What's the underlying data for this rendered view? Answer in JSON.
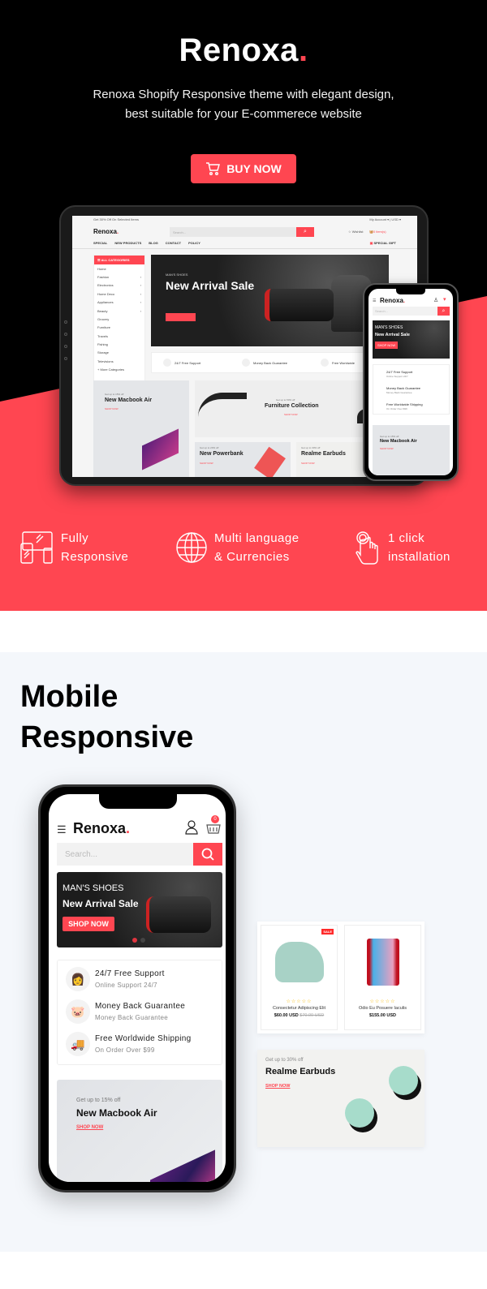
{
  "hero": {
    "brand": "Renoxa",
    "brand_dot": ".",
    "tagline_line1": "Renoxa Shopify Responsive theme with elegant design,",
    "tagline_line2": "best suitable for your E-commerece website",
    "buy_button": "BUY NOW",
    "colors": {
      "accent": "#ff4651",
      "dark": "#000000"
    }
  },
  "tablet": {
    "topbar_left": "Get 30% Off On Selected Items",
    "topbar_right": "My Account ▾  |  USD ▾",
    "logo": "Renoxa",
    "search_placeholder": "Search...",
    "wishlist": "Wishlist",
    "cart": "0 item(s)",
    "nav": [
      "SPECIAL",
      "NEW PRODUCTS",
      "BLOG",
      "CONTACT",
      "POLICY"
    ],
    "special_gift": "SPECIAL GIFT",
    "categories_header": "ALL CATEGORIES",
    "categories": [
      {
        "label": "Home",
        "arrow": ""
      },
      {
        "label": "Fashion",
        "arrow": "›"
      },
      {
        "label": "Electronics",
        "arrow": "›"
      },
      {
        "label": "Home Deco",
        "arrow": "›"
      },
      {
        "label": "Appliances",
        "arrow": "›"
      },
      {
        "label": "Beauty",
        "arrow": "›"
      },
      {
        "label": "Grocery",
        "arrow": ""
      },
      {
        "label": "Furniture",
        "arrow": ""
      },
      {
        "label": "Travels",
        "arrow": ""
      },
      {
        "label": "Fishing",
        "arrow": ""
      },
      {
        "label": "Storage",
        "arrow": ""
      },
      {
        "label": "Televisions",
        "arrow": ""
      },
      {
        "label": "+ More Categories",
        "arrow": ""
      }
    ],
    "banner_sub": "MAN'S SHOES",
    "banner_title": "New Arrival Sale",
    "features": [
      "24/7 Free Support",
      "Money Back Guarantee",
      "Free Worldwide"
    ],
    "promos": [
      {
        "sub": "Get up to 15% off",
        "title": "New Macbook Air",
        "link": "SHOP NOW"
      },
      {
        "sub": "Get up to 50% off",
        "title": "Furniture Collection",
        "link": "SHOP NOW"
      },
      {
        "sub": "Get up to 20% off",
        "title": "New Powerbank",
        "link": "SHOP NOW"
      },
      {
        "sub": "Get up to 30% off",
        "title": "Realme Earbuds",
        "link": "SHOP NOW"
      }
    ]
  },
  "features_strip": [
    {
      "line1": "Fully",
      "line2": "Responsive",
      "icon": "devices-icon"
    },
    {
      "line1": "Multi language",
      "line2": "& Currencies",
      "icon": "globe-icon"
    },
    {
      "line1": "1 click",
      "line2": "installation",
      "icon": "tap-hand-icon"
    }
  ],
  "mobile_section": {
    "title_line1": "Mobile",
    "title_line2": "Responsive",
    "phone": {
      "logo": "Renoxa",
      "cart_count": "0",
      "search_placeholder": "Search...",
      "banner_sub": "MAN'S SHOES",
      "banner_title": "New Arrival Sale",
      "banner_button": "SHOP NOW",
      "features": [
        {
          "title": "24/7 Free Support",
          "sub": "Online Support 24/7",
          "icon": "support-agent-icon"
        },
        {
          "title": "Money Back Guarantee",
          "sub": "Money Back Guarantee",
          "icon": "piggy-bank-icon"
        },
        {
          "title": "Free Worldwide Shipping",
          "sub": "On Order Over $99",
          "icon": "truck-icon"
        }
      ],
      "promo": {
        "sub": "Get up to 15% off",
        "title": "New Macbook Air",
        "link": "SHOP NOW"
      }
    },
    "products": [
      {
        "name": "Consectetur Adipiscing Elit",
        "price": "$60.00 USD",
        "old_price": "$70.00 USD",
        "badge": "SALE",
        "rating": 0
      },
      {
        "name": "Odio Eu Posuere Iaculis",
        "price": "$155.00 USD",
        "old_price": "",
        "badge": "",
        "rating": 0
      }
    ],
    "earbuds_promo": {
      "sub": "Get up to 30% off",
      "title": "Realme Earbuds",
      "link": "SHOP NOW"
    }
  }
}
